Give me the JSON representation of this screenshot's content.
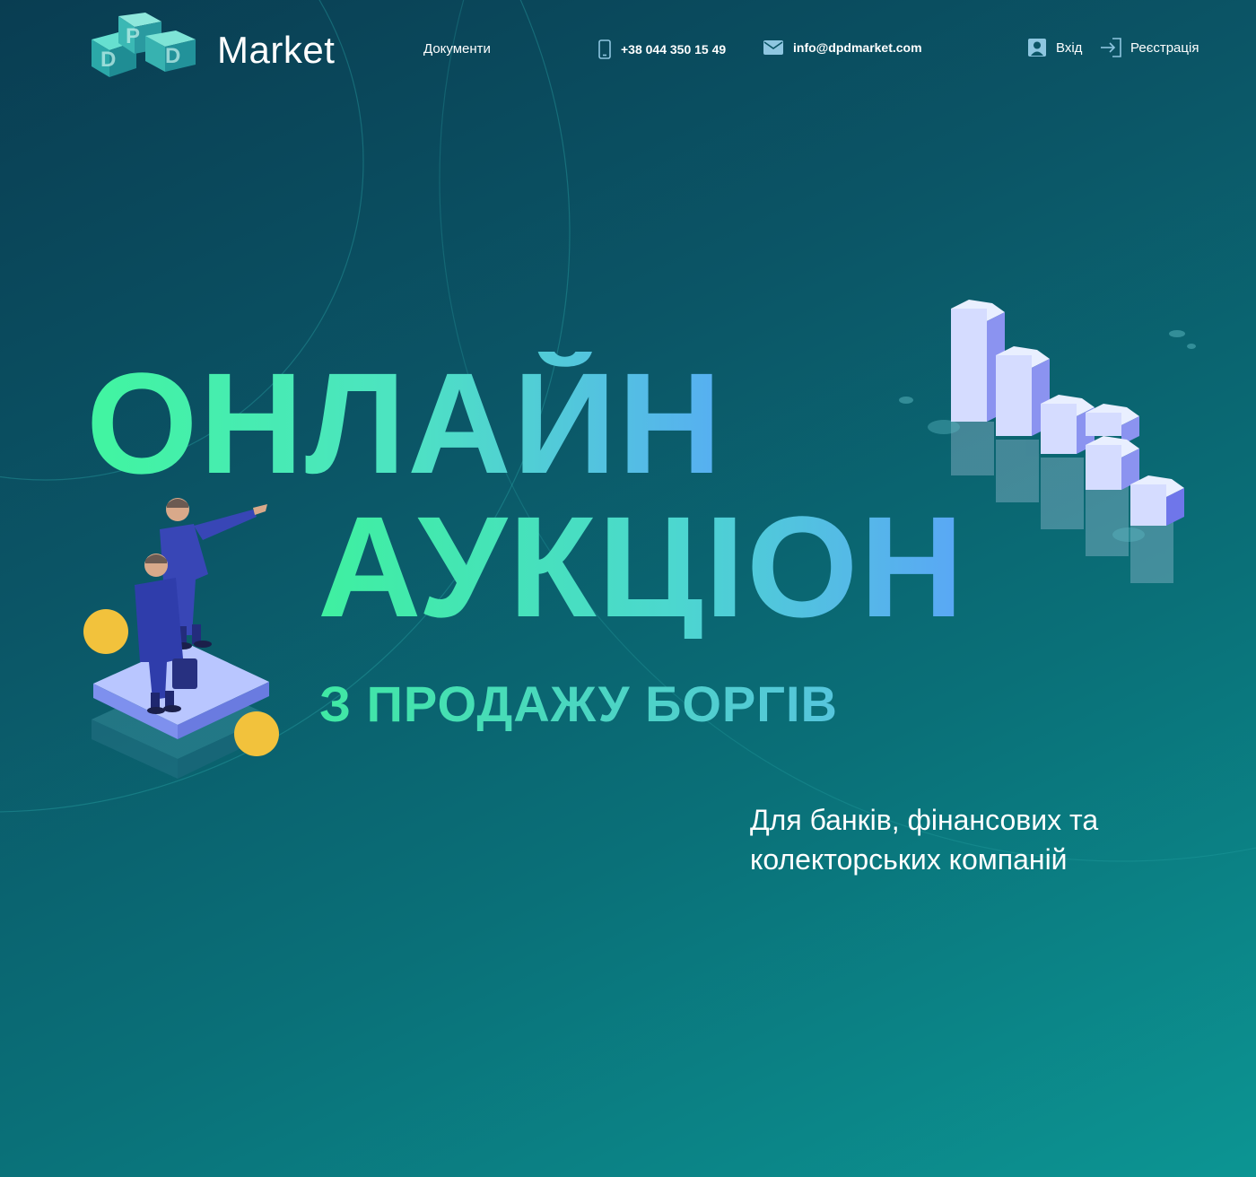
{
  "header": {
    "logo_text": "Market",
    "nav_documents": "Документи",
    "phone": "+38 044 350 15 49",
    "email": "info@dpdmarket.com",
    "login": "Вхід",
    "register": "Реєстрація"
  },
  "hero": {
    "title_line1": "ОНЛАЙН",
    "title_line2": "АУКЦІОН",
    "subtitle": "З ПРОДАЖУ БОРГІВ",
    "description_line1": "Для банків, фінансових та",
    "description_line2": "колекторських компаній"
  },
  "icons": {
    "phone": "phone-icon",
    "email": "envelope-icon",
    "login": "user-icon",
    "register": "sign-in-icon"
  },
  "colors": {
    "background_start": "#093d52",
    "background_end": "#0c9593",
    "accent_green": "#41f5a0",
    "accent_blue": "#57aef2",
    "coin": "#f2c23c"
  }
}
